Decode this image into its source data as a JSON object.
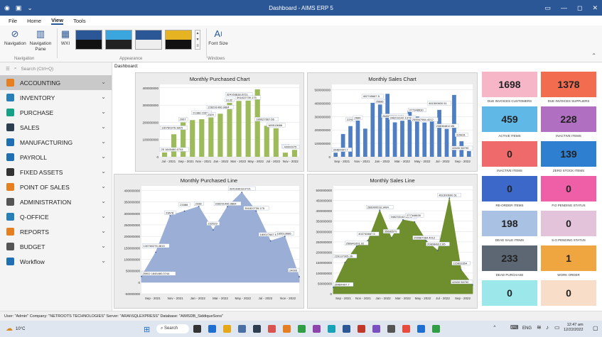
{
  "titlebar": {
    "title": "Dashboard - AIMS ERP 5"
  },
  "menu": [
    "File",
    "Home",
    "View",
    "Tools"
  ],
  "ribbon": {
    "nav1": "Navigation",
    "nav2": "Navigation Pane",
    "wxi": "WXI",
    "font": "Font Size",
    "g_nav": "Navigation",
    "g_app": "Appearance",
    "g_win": "Windows"
  },
  "sidebar": {
    "search_placeholder": "Search (Ctrl+Q)",
    "items": [
      {
        "label": "ACCOUNTING",
        "color": "#e67e22"
      },
      {
        "label": "INVENTORY",
        "color": "#2980b9"
      },
      {
        "label": "PURCHASE",
        "color": "#16a085"
      },
      {
        "label": "SALES",
        "color": "#2c3e50"
      },
      {
        "label": "MANUFACTURING",
        "color": "#1f6fb2"
      },
      {
        "label": "PAYROLL",
        "color": "#1f6fb2"
      },
      {
        "label": "FIXED ASSETS",
        "color": "#333333"
      },
      {
        "label": "POINT OF SALES",
        "color": "#e67e22"
      },
      {
        "label": "ADMINISTRATION",
        "color": "#555555"
      },
      {
        "label": "Q-OFFICE",
        "color": "#2980b9"
      },
      {
        "label": "REPORTS",
        "color": "#e67e22"
      },
      {
        "label": "BUDGET",
        "color": "#555555"
      },
      {
        "label": "Workflow",
        "color": "#1f6fb2"
      }
    ]
  },
  "dashboard_label": "Dashboard:",
  "chart_data": [
    {
      "type": "bar",
      "title": "Monthly Purchased Chart",
      "color": "#9dbb5a",
      "xticks": [
        "Jul - 2021",
        "Sep - 2021",
        "Nov - 2021",
        "Jan - 2022",
        "Mar - 2022",
        "May - 2022",
        "Jul - 2022",
        "Nov - 2022"
      ],
      "yticks": [
        "400000000",
        "300000000",
        "200000000",
        "100000000",
        "0"
      ],
      "ylim": [
        0,
        420000000
      ],
      "values": [
        25000000,
        130760276,
        200000000,
        213000000,
        218000000,
        228291496,
        250000000,
        313000000,
        324163618,
        326000000,
        391822739,
        180027667,
        165513686,
        24000000,
        40000000
      ],
      "labels": [
        "25 1845480.0744",
        "130760276.3815",
        "2067",
        "21388 2332",
        "2329",
        "228291496.9864",
        "3132",
        "324163618.0721",
        "391822739.175",
        "180027667.66",
        "165513686",
        "240",
        "40000075"
      ]
    },
    {
      "type": "bar",
      "title": "Monthly Sales Chart",
      "color": "#4f7ec2",
      "xticks": [
        "Sep - 2021",
        "Nov - 2021",
        "Jan - 2022",
        "Mar - 2022",
        "May - 2022",
        "Jul - 2022",
        "Sep - 2022"
      ],
      "yticks": [
        "500000000",
        "400000000",
        "300000000",
        "200000000",
        "100000000",
        "0"
      ],
      "ylim": [
        0,
        540000000
      ],
      "values": [
        30484497,
        170000000,
        229000000,
        270000000,
        210000000,
        402745667,
        390000000,
        470000000,
        256841691,
        268900018,
        346233142,
        300000000,
        255567984,
        280000000,
        350000000,
        208084812,
        461500000,
        115831654,
        42630567
      ],
      "labels": [
        "30484497.7",
        "2291",
        "2689",
        "402745667.5",
        "25686",
        "268900018.1484",
        "346233142.1373",
        "277348630",
        "255567984.4012",
        "461500600.51",
        "208084812.85",
        "115831",
        "42630 56790"
      ]
    },
    {
      "type": "area",
      "title": "Monthly Purchased Line",
      "color": "#9aaed6",
      "xticks": [
        "Sep - 2021",
        "Nov - 2021",
        "Jan - 2022",
        "Mar - 2022",
        "May - 2022",
        "Jul - 2022",
        "Nov - 2022"
      ],
      "yticks": [
        "400000000",
        "350000000",
        "300000000",
        "250000000",
        "200000000",
        "150000000",
        "100000000",
        "50000000",
        "0",
        "-50000000"
      ],
      "ylim": [
        -50000000,
        420000000
      ],
      "values": [
        25000000,
        130760276,
        290000000,
        310000000,
        330000000,
        228000000,
        330000000,
        391822739,
        310000000,
        180027667,
        200000000,
        24000000
      ],
      "labels": [
        "25902 1845480.0744",
        "130760276.3815",
        "29678",
        "23388",
        "2338",
        "232029",
        "228291496.9864",
        "324163618.0721",
        "391822739.175",
        "180027667.66",
        "165513686",
        "24000"
      ]
    },
    {
      "type": "area",
      "title": "Monthly Sales Line",
      "color": "#6f8f2e",
      "xticks": [
        "Sep - 2021",
        "Nov - 2021",
        "Jan - 2022",
        "Mar - 2022",
        "May - 2022",
        "Jul - 2022",
        "Sep - 2022"
      ],
      "yticks": [
        "500000000",
        "450000000",
        "400000000",
        "350000000",
        "300000000",
        "250000000",
        "200000000",
        "150000000",
        "100000000",
        "50000000",
        "0"
      ],
      "ylim": [
        0,
        520000000
      ],
      "values": [
        30484497,
        150000000,
        229373005,
        256841691,
        402745667,
        268900018,
        356000000,
        346233142,
        255567984,
        208084812,
        461500000,
        115831654,
        42630567
      ],
      "labels": [
        "30484497.7",
        "229137305.36",
        "256841691.92",
        "402745667.5",
        "268900018.1484",
        "35686579",
        "346233142.1373",
        "277348630",
        "255567984.4012",
        "208084812.85",
        "461500600.51",
        "115831654",
        "42630 56790"
      ]
    }
  ],
  "tiles": [
    {
      "value": "1698",
      "label": "DUE INVOICES CUSTOMERS",
      "bg": "#f7b6c8"
    },
    {
      "value": "1378",
      "label": "DUE INVOICES SUPPLIERS",
      "bg": "#f26c4f"
    },
    {
      "value": "459",
      "label": "ACTIVE ITEMS",
      "bg": "#5fb8e6"
    },
    {
      "value": "228",
      "label": "INACTIVE ITEMS",
      "bg": "#b06fc1"
    },
    {
      "value": "0",
      "label": "INACTIVE ITEMS",
      "bg": "#ef6b6b"
    },
    {
      "value": "139",
      "label": "ZERO STOCK ITEMS",
      "bg": "#2f7fd1"
    },
    {
      "value": "0",
      "label": "RE-ORDER ITEMS",
      "bg": "#3b68c9"
    },
    {
      "value": "0",
      "label": "P.O PENDING STATUS",
      "bg": "#ef5fa8"
    },
    {
      "value": "198",
      "label": "DEAD SALE ITEMS",
      "bg": "#a9c1e2"
    },
    {
      "value": "0",
      "label": "S.O PENDING STATUS",
      "bg": "#e2c3da"
    },
    {
      "value": "233",
      "label": "DEAD PURCHASE",
      "bg": "#5d6673"
    },
    {
      "value": "1",
      "label": "WORK ORDER",
      "bg": "#f0a640"
    },
    {
      "value": "0",
      "label": "",
      "bg": "#9be7ea"
    },
    {
      "value": "0",
      "label": "",
      "bg": "#f8ddc8"
    }
  ],
  "status": "User: \"Admin\"   Company: \"NETROOTS TECHNOLOGIES\"   Server: \"ARAI\\SQLEXPRESS\"   Database: \"AIMSDB_SiddiqueSons\"",
  "taskbar": {
    "weather": "10°C",
    "search": "Search",
    "lang": "ENG",
    "time": "12:47 am",
    "date": "12/22/2022"
  }
}
